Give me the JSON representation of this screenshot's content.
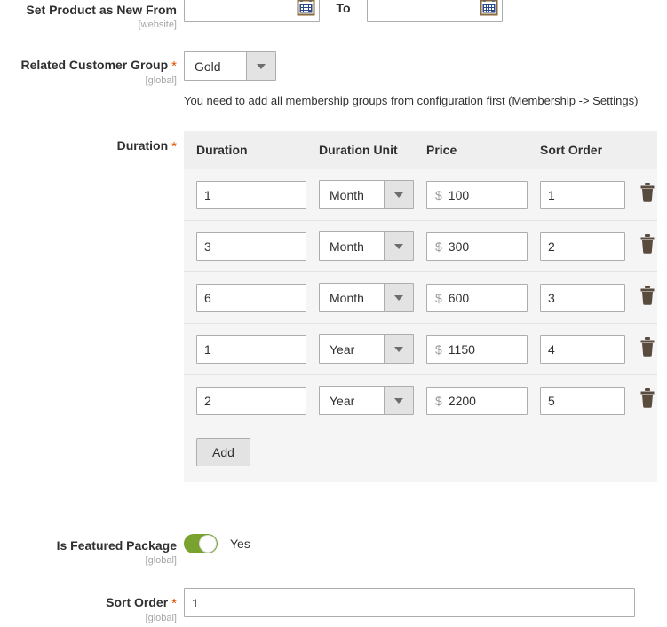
{
  "fields": {
    "set_new_from": {
      "label": "Set Product as New From",
      "scope": "[website]",
      "from_value": "",
      "from_placeholder": "",
      "to_label": "To",
      "to_value": "",
      "to_placeholder": "",
      "calendar_icon": "calendar-icon"
    },
    "related_customer_group": {
      "label": "Related Customer Group",
      "scope": "[global]",
      "required_marker": "*",
      "selected": "Gold",
      "options": [
        "Gold"
      ],
      "note": "You need to add all membership groups from configuration first (Membership -> Settings)"
    },
    "duration": {
      "label": "Duration",
      "scope": "",
      "required_marker": "*",
      "columns": [
        "Duration",
        "Duration Unit",
        "Price",
        "Sort Order"
      ],
      "price_symbol": "$",
      "delete_icon": "trash-icon",
      "add_label": "Add",
      "rows": [
        {
          "duration": "1",
          "unit": "Month",
          "price": "100",
          "sort_order": "1"
        },
        {
          "duration": "3",
          "unit": "Month",
          "price": "300",
          "sort_order": "2"
        },
        {
          "duration": "6",
          "unit": "Month",
          "price": "600",
          "sort_order": "3"
        },
        {
          "duration": "1",
          "unit": "Year",
          "price": "1150",
          "sort_order": "4"
        },
        {
          "duration": "2",
          "unit": "Year",
          "price": "2200",
          "sort_order": "5"
        }
      ]
    },
    "is_featured_package": {
      "label": "Is Featured Package",
      "scope": "[global]",
      "state_label": "Yes",
      "checked": true,
      "on_color": "#79a22e"
    },
    "sort_order": {
      "label": "Sort Order",
      "scope": "[global]",
      "required_marker": "*",
      "value": "1",
      "placeholder": ""
    }
  },
  "theme": {
    "required_color": "#e04f00",
    "scope_color": "#a6a6a6",
    "table_bg": "#f5f5f5",
    "table_header_bg": "#efefef"
  }
}
